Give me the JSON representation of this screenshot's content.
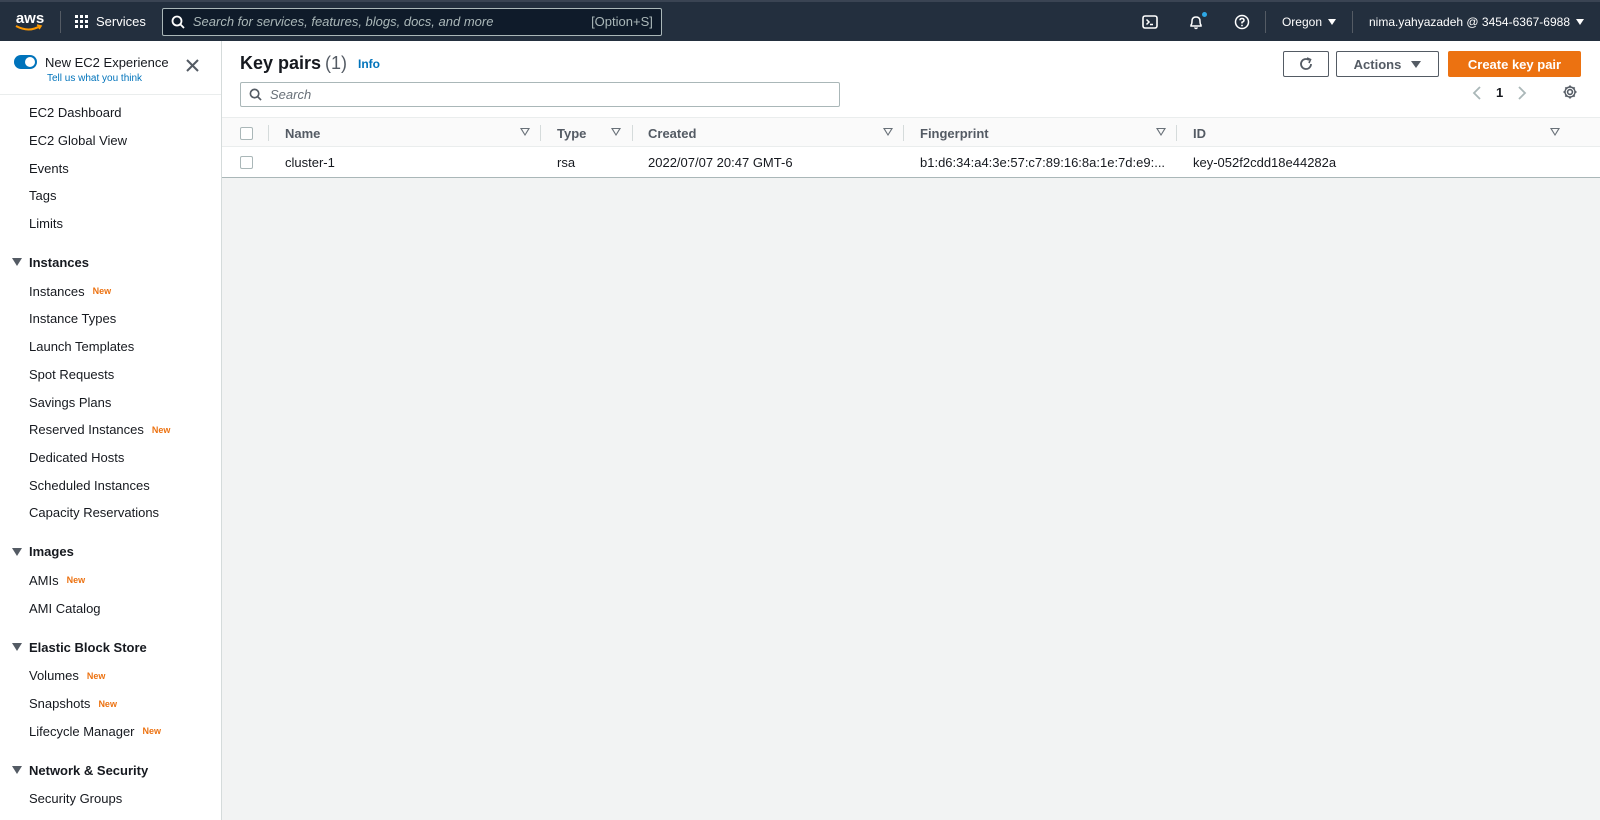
{
  "topnav": {
    "logo": "aws",
    "services_label": "Services",
    "search_placeholder": "Search for services, features, blogs, docs, and more",
    "search_shortcut": "[Option+S]",
    "region": "Oregon",
    "account": "nima.yahyazadeh @ 3454-6367-6988",
    "icons": [
      "cloudshell-icon",
      "bell-icon",
      "help-icon"
    ]
  },
  "sidebar": {
    "experience_title": "New EC2 Experience",
    "experience_sub": "Tell us what you think",
    "top_items": [
      "EC2 Dashboard",
      "EC2 Global View",
      "Events",
      "Tags",
      "Limits"
    ],
    "new_badge": "New",
    "sections": [
      {
        "label": "Instances",
        "items": [
          {
            "label": "Instances",
            "new": true
          },
          {
            "label": "Instance Types",
            "new": false
          },
          {
            "label": "Launch Templates",
            "new": false
          },
          {
            "label": "Spot Requests",
            "new": false
          },
          {
            "label": "Savings Plans",
            "new": false
          },
          {
            "label": "Reserved Instances",
            "new": true
          },
          {
            "label": "Dedicated Hosts",
            "new": false
          },
          {
            "label": "Scheduled Instances",
            "new": false
          },
          {
            "label": "Capacity Reservations",
            "new": false
          }
        ]
      },
      {
        "label": "Images",
        "items": [
          {
            "label": "AMIs",
            "new": true
          },
          {
            "label": "AMI Catalog",
            "new": false
          }
        ]
      },
      {
        "label": "Elastic Block Store",
        "items": [
          {
            "label": "Volumes",
            "new": true
          },
          {
            "label": "Snapshots",
            "new": true
          },
          {
            "label": "Lifecycle Manager",
            "new": true
          }
        ]
      },
      {
        "label": "Network & Security",
        "items": [
          {
            "label": "Security Groups",
            "new": false
          }
        ]
      }
    ]
  },
  "main": {
    "title": "Key pairs",
    "count": "(1)",
    "info": "Info",
    "actions_label": "Actions",
    "create_label": "Create key pair",
    "search_placeholder": "Search",
    "page": "1",
    "columns": [
      "Name",
      "Type",
      "Created",
      "Fingerprint",
      "ID"
    ],
    "rows": [
      {
        "name": "cluster-1",
        "type": "rsa",
        "created": "2022/07/07 20:47 GMT-6",
        "fingerprint": "b1:d6:34:a4:3e:57:c7:89:16:8a:1e:7d:e9:...",
        "id": "key-052f2cdd18e44282a"
      }
    ]
  },
  "colors": {
    "nav_bg": "#232f3e",
    "accent_orange": "#ec7211",
    "link_blue": "#0073bb"
  }
}
